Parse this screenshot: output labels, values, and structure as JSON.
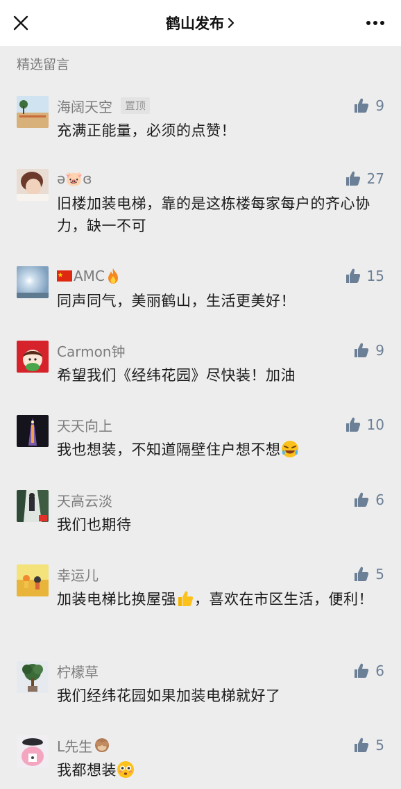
{
  "nav": {
    "title": "鹤山发布",
    "close_icon": "close-icon",
    "more_icon": "more-icon"
  },
  "section": {
    "label": "精选留言"
  },
  "colors": {
    "background": "#ededed",
    "nick": "#7c7c7c",
    "like": "#6b7f96"
  },
  "comments": [
    {
      "nick": "海阔天空",
      "pin": "置顶",
      "likes": "9",
      "text": "充满正能量，必须的点赞！"
    },
    {
      "nick": "ə🐷ɞ",
      "likes": "27",
      "text": "旧楼加装电梯，靠的是这栋楼每家每户的齐心协力，缺一不可"
    },
    {
      "nick": "AMC",
      "nick_prefix_icon": "china-flag-icon",
      "nick_suffix_icon": "fire-icon",
      "likes": "15",
      "text": "同声同气，美丽鹤山，生活更美好！"
    },
    {
      "nick": "Carmon钟",
      "likes": "9",
      "text": "希望我们《经纬花园》尽快装！加油"
    },
    {
      "nick": "天天向上",
      "likes": "10",
      "text": "我也想装，不知道隔壁住户想不想",
      "text_suffix_icon": "laugh-cry-emoji"
    },
    {
      "nick": "天高云淡",
      "likes": "6",
      "text": "我们也期待"
    },
    {
      "nick": "幸运儿",
      "likes": "5",
      "text_before": "加装电梯比换屋强",
      "text_icon": "thumbs-up-emoji",
      "text_after": "，喜欢在市区生活，便利！"
    },
    {
      "nick": "柠檬草",
      "likes": "6",
      "text": "我们经纬花园如果加装电梯就好了"
    },
    {
      "nick": "L先生",
      "nick_suffix_icon": "see-no-evil-monkey-icon",
      "likes": "5",
      "text": "我都想装",
      "text_suffix_icon": "flushed-emoji"
    }
  ]
}
